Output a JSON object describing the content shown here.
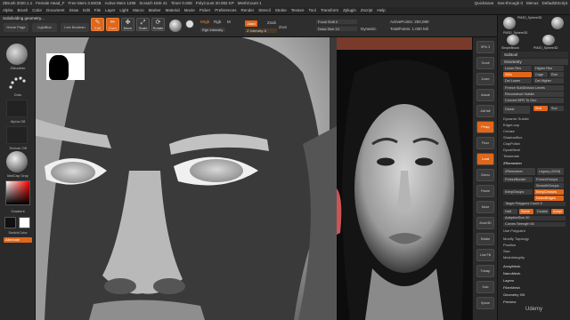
{
  "title_bar": {
    "items": [
      "ZBrush 2020.1.1",
      "Female Head_F",
      "Free Mem 3.60GB",
      "Active Mem 1298",
      "Scratch Disk 41",
      "Timer 0.008",
      "PolyCount 20.082 KP",
      "MeshCount 1"
    ],
    "right": [
      "QuickSave",
      "See-through 0",
      "Menus",
      "DefaultZScript"
    ]
  },
  "menu": [
    "Alpha",
    "Brush",
    "Color",
    "Document",
    "Draw",
    "Edit",
    "File",
    "Layer",
    "Light",
    "Macro",
    "Marker",
    "Material",
    "Movie",
    "Picker",
    "Preferences",
    "Render",
    "Stencil",
    "Stroke",
    "Texture",
    "Tool",
    "Transform",
    "Zplugin",
    "Zscript",
    "Help"
  ],
  "status_text": "Subdividing geometry...",
  "toolbar": {
    "home": "Home Page",
    "lightbox": "LightBox",
    "live_boolean": "Live Boolean",
    "edit": "Edit",
    "draw": "Draw",
    "move": "Move",
    "scale": "Scale",
    "rotate": "Rotate",
    "mrgb": "Mrgb",
    "rgb": "Rgb",
    "m": "M",
    "zadd": "Zadd",
    "zsub": "Zsub",
    "zcut": "Zcut",
    "rgb_intensity": "Rgb Intensity",
    "z_intensity": "Z Intensity 8",
    "focal_shift": "Focal Shift 0",
    "draw_size": "Draw Size 10",
    "dynamic": "Dynamic",
    "active_points": "ActivePoints: 250,080",
    "total_points": "TotalPoints: 1.000 Mil"
  },
  "left_shelf": {
    "brush": "ZModeler",
    "stroke": "Dots",
    "alpha": "Alpha Off",
    "texture": "Texture Off",
    "material": "MatCap Gray",
    "gradient": "Gradient",
    "switch_color": "SwitchColor",
    "alternate": "Alternate"
  },
  "right_column": [
    "SPix 3",
    "Scroll",
    "Zoom",
    "Actual",
    "AAHalf",
    "Persp",
    "Floor",
    "Local",
    "Gizmo",
    "Frame",
    "Move",
    "Zoom3D",
    "Rotate",
    "Line Fill",
    "Transp",
    "Solo",
    "Xpose"
  ],
  "tray": {
    "top_thumbs": [
      "PM3D_Sphere3D",
      "PM3D_Sphere3D",
      "SimpleBrush",
      "PM3D_Sphere3D"
    ],
    "subtool": "Subtool",
    "geometry": "Geometry",
    "lower_res": "Lower Res",
    "higher_res": "Higher Res",
    "sdiv": "SDiv",
    "del_lower": "Del Lower",
    "del_higher": "Del Higher",
    "freeze_subdiv": "Freeze SubDivision Levels",
    "reconstruct": "Reconstruct Subdiv",
    "convert_bpr": "Convert BPR To Geo",
    "divide": "Divide",
    "smt": "Smt",
    "suv": "Suv",
    "items_a": [
      "Dynamic Subdiv",
      "EdgeLoop",
      "Crease",
      "ShadowBox",
      "ClayPolish",
      "DynaMesh",
      "Tessimate"
    ],
    "zremesher_title": "ZRemesher",
    "zremesher_btn": "ZRemesher",
    "legacy": "Legacy (2018)",
    "freeze_border": "FreezeBorder",
    "freeze_groups": "FreezeGroups",
    "smooth_groups": "SmoothGroups",
    "keep_groups": "KeepGroups",
    "keep_creases": "KeepCreases",
    "detect_edges": "DetectEdges",
    "target_polys": "Target Polygons Count 5",
    "half": "Half",
    "same": "Same",
    "double": "Double",
    "adapt": "Adapt",
    "adaptive_size": "AdaptiveSize 50",
    "curves_strength": "Curves Strength 50",
    "use_polypaint": "Use Polypaint",
    "items_b": [
      "Modify Topology",
      "Position",
      "Size",
      "MeshIntegrity"
    ],
    "items_c": [
      "ArrayMesh",
      "NanoMesh",
      "Layers",
      "FiberMesh",
      "Geometry HD",
      "Preview"
    ]
  },
  "watermark": "Udemy"
}
